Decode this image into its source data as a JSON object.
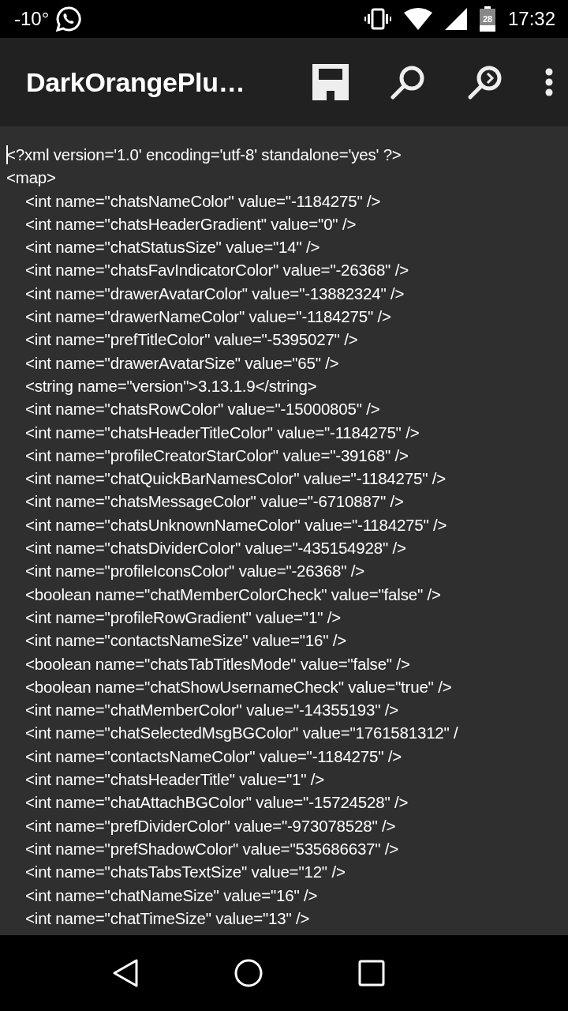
{
  "status_bar": {
    "temperature": "-10°",
    "battery": "28",
    "time": "17:32"
  },
  "toolbar": {
    "title": "DarkOrangePlu…"
  },
  "editor": {
    "cursor": true,
    "lines": [
      {
        "kind": "root",
        "text": "<?xml version='1.0' encoding='utf-8' standalone='yes' ?>"
      },
      {
        "kind": "root",
        "text": "<map>"
      },
      {
        "kind": "entry",
        "text": "<int name=\"chatsNameColor\" value=\"-1184275\" />"
      },
      {
        "kind": "entry",
        "text": "<int name=\"chatsHeaderGradient\" value=\"0\" />"
      },
      {
        "kind": "entry",
        "text": "<int name=\"chatStatusSize\" value=\"14\" />"
      },
      {
        "kind": "entry",
        "text": "<int name=\"chatsFavIndicatorColor\" value=\"-26368\" />"
      },
      {
        "kind": "entry",
        "text": "<int name=\"drawerAvatarColor\" value=\"-13882324\" />"
      },
      {
        "kind": "entry",
        "text": "<int name=\"drawerNameColor\" value=\"-1184275\" />"
      },
      {
        "kind": "entry",
        "text": "<int name=\"prefTitleColor\" value=\"-5395027\" />"
      },
      {
        "kind": "entry",
        "text": "<int name=\"drawerAvatarSize\" value=\"65\" />"
      },
      {
        "kind": "entry",
        "text": "<string name=\"version\">3.13.1.9</string>"
      },
      {
        "kind": "entry",
        "text": "<int name=\"chatsRowColor\" value=\"-15000805\" />"
      },
      {
        "kind": "entry",
        "text": "<int name=\"chatsHeaderTitleColor\" value=\"-1184275\" />"
      },
      {
        "kind": "entry",
        "text": "<int name=\"profileCreatorStarColor\" value=\"-39168\" />"
      },
      {
        "kind": "entry",
        "text": "<int name=\"chatQuickBarNamesColor\" value=\"-1184275\" />"
      },
      {
        "kind": "entry",
        "text": "<int name=\"chatsMessageColor\" value=\"-6710887\" />"
      },
      {
        "kind": "entry",
        "text": "<int name=\"chatsUnknownNameColor\" value=\"-1184275\" />"
      },
      {
        "kind": "entry",
        "text": "<int name=\"chatsDividerColor\" value=\"-435154928\" />"
      },
      {
        "kind": "entry",
        "text": "<int name=\"profileIconsColor\" value=\"-26368\" />"
      },
      {
        "kind": "entry",
        "text": "<boolean name=\"chatMemberColorCheck\" value=\"false\" />"
      },
      {
        "kind": "entry",
        "text": "<int name=\"profileRowGradient\" value=\"1\" />"
      },
      {
        "kind": "entry",
        "text": "<int name=\"contactsNameSize\" value=\"16\" />"
      },
      {
        "kind": "entry",
        "text": "<boolean name=\"chatsTabTitlesMode\" value=\"false\" />"
      },
      {
        "kind": "entry",
        "text": "<boolean name=\"chatShowUsernameCheck\" value=\"true\" />"
      },
      {
        "kind": "entry",
        "text": "<int name=\"chatMemberColor\" value=\"-14355193\" />"
      },
      {
        "kind": "entry",
        "text": "<int name=\"chatSelectedMsgBGColor\" value=\"1761581312\" /"
      },
      {
        "kind": "entry",
        "text": "<int name=\"contactsNameColor\" value=\"-1184275\" />"
      },
      {
        "kind": "entry",
        "text": "<int name=\"chatsHeaderTitle\" value=\"1\" />"
      },
      {
        "kind": "entry",
        "text": "<int name=\"chatAttachBGColor\" value=\"-15724528\" />"
      },
      {
        "kind": "entry",
        "text": "<int name=\"prefDividerColor\" value=\"-973078528\" />"
      },
      {
        "kind": "entry",
        "text": "<int name=\"prefShadowColor\" value=\"535686637\" />"
      },
      {
        "kind": "entry",
        "text": "<int name=\"chatsTabsTextSize\" value=\"12\" />"
      },
      {
        "kind": "entry",
        "text": "<int name=\"chatNameSize\" value=\"16\" />"
      },
      {
        "kind": "entry",
        "text": "<int name=\"chatTimeSize\" value=\"13\" />"
      }
    ]
  }
}
